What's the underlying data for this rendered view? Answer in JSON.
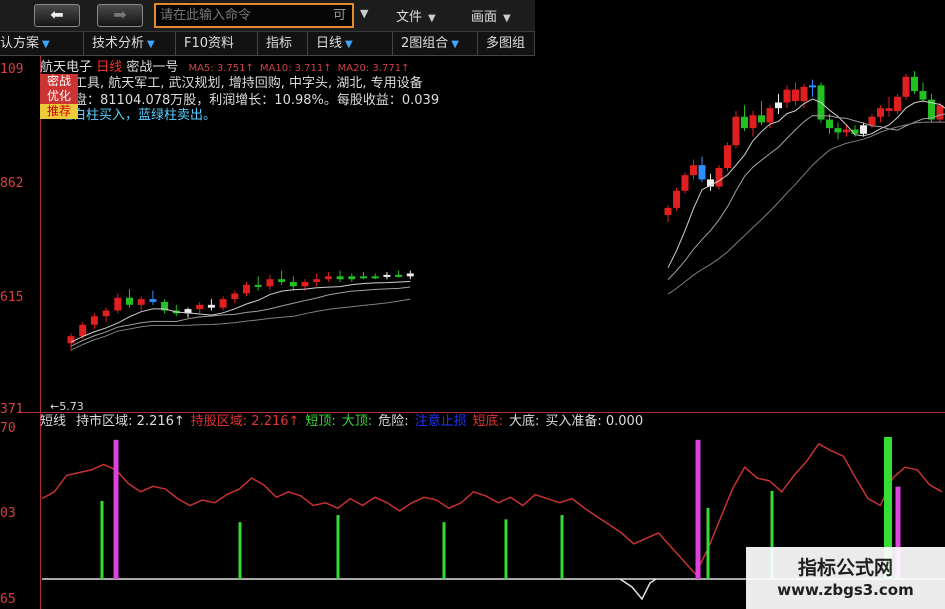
{
  "toolbar": {
    "back_icon": "back-arrow-icon",
    "forward_icon": "forward-arrow-icon",
    "command_placeholder": "请在此输入命令",
    "command_suffix": "可",
    "menu_file": "文件",
    "menu_view": "画面",
    "row2": [
      {
        "label": "认方案",
        "dropdown": true
      },
      {
        "label": "技术分析",
        "dropdown": true
      },
      {
        "label": "F10资料",
        "dropdown": false
      },
      {
        "label": "指标",
        "dropdown": false
      },
      {
        "label": "日线",
        "dropdown": true
      },
      {
        "label": "2图组合",
        "dropdown": true
      },
      {
        "label": "多图组",
        "dropdown": false
      }
    ]
  },
  "stock": {
    "name": "航天电子",
    "period": "日线",
    "strategy": "密战一号",
    "ma": [
      {
        "label": "MA5:",
        "value": "3.751"
      },
      {
        "label": "MA10:",
        "value": "3.711"
      },
      {
        "label": "MA20:",
        "value": "3.771"
      }
    ],
    "concepts": "交通工具, 航天军工, 武汉规划, 增持回购, 中字头, 湖北, 专用设备",
    "stats": "畅通盘：81104.078万股，利润增长：10.98%。每股收益：0.039",
    "hint_buy": "红白柱买入，",
    "hint_sell": "蓝绿柱卖出。"
  },
  "tags": [
    "密战",
    "优化",
    "推荐"
  ],
  "y_axis": {
    "main": [
      "109",
      "862",
      "615",
      "371"
    ],
    "indicator": [
      "70",
      "03",
      "65"
    ],
    "min_label": "←5.73"
  },
  "indicator": {
    "name": "短线",
    "items": [
      {
        "text": "持市区域: 2.216↑",
        "color": "#dddddd"
      },
      {
        "text": "持股区域: 2.216↑",
        "color": "#e33333"
      },
      {
        "text": "短顶:",
        "color": "#33dd33"
      },
      {
        "text": "大顶:",
        "color": "#33dd33"
      },
      {
        "text": "危险:",
        "color": "#dddddd"
      },
      {
        "text": "注意止损",
        "color": "#2233ff"
      },
      {
        "text": "短底:",
        "color": "#e33333"
      },
      {
        "text": "大底:",
        "color": "#dddddd"
      },
      {
        "text": "买入准备: 0.000",
        "color": "#dddddd"
      }
    ]
  },
  "watermark": {
    "title": "指标公式网",
    "url": "www.zbgs3.com"
  },
  "colors": {
    "up": "#e02020",
    "down": "#22c022",
    "buy_signal": "#f0f0f0",
    "sell_signal": "#2f8fff",
    "line": "#c83232",
    "ma": "#b0b0b0"
  },
  "chart_data": {
    "type": "candlestick",
    "candles": [
      {
        "o": 4.15,
        "h": 4.22,
        "l": 4.1,
        "c": 4.2,
        "t": "up"
      },
      {
        "o": 4.2,
        "h": 4.3,
        "l": 4.18,
        "c": 4.28,
        "t": "up"
      },
      {
        "o": 4.28,
        "h": 4.36,
        "l": 4.25,
        "c": 4.34,
        "t": "up"
      },
      {
        "o": 4.34,
        "h": 4.4,
        "l": 4.3,
        "c": 4.38,
        "t": "up"
      },
      {
        "o": 4.38,
        "h": 4.5,
        "l": 4.36,
        "c": 4.47,
        "t": "up"
      },
      {
        "o": 4.47,
        "h": 4.53,
        "l": 4.4,
        "c": 4.42,
        "t": "down"
      },
      {
        "o": 4.42,
        "h": 4.48,
        "l": 4.38,
        "c": 4.46,
        "t": "up"
      },
      {
        "o": 4.46,
        "h": 4.52,
        "l": 4.42,
        "c": 4.44,
        "t": "sell"
      },
      {
        "o": 4.44,
        "h": 4.46,
        "l": 4.36,
        "c": 4.38,
        "t": "down"
      },
      {
        "o": 4.38,
        "h": 4.42,
        "l": 4.34,
        "c": 4.36,
        "t": "down"
      },
      {
        "o": 4.36,
        "h": 4.4,
        "l": 4.33,
        "c": 4.39,
        "t": "buy"
      },
      {
        "o": 4.39,
        "h": 4.44,
        "l": 4.36,
        "c": 4.42,
        "t": "up"
      },
      {
        "o": 4.42,
        "h": 4.46,
        "l": 4.38,
        "c": 4.4,
        "t": "buy"
      },
      {
        "o": 4.4,
        "h": 4.48,
        "l": 4.38,
        "c": 4.46,
        "t": "up"
      },
      {
        "o": 4.46,
        "h": 4.52,
        "l": 4.43,
        "c": 4.5,
        "t": "up"
      },
      {
        "o": 4.5,
        "h": 4.58,
        "l": 4.48,
        "c": 4.56,
        "t": "up"
      },
      {
        "o": 4.56,
        "h": 4.62,
        "l": 4.52,
        "c": 4.55,
        "t": "down"
      },
      {
        "o": 4.55,
        "h": 4.63,
        "l": 4.53,
        "c": 4.6,
        "t": "up"
      },
      {
        "o": 4.6,
        "h": 4.66,
        "l": 4.56,
        "c": 4.58,
        "t": "down"
      },
      {
        "o": 4.58,
        "h": 4.62,
        "l": 4.52,
        "c": 4.55,
        "t": "down"
      },
      {
        "o": 4.55,
        "h": 4.6,
        "l": 4.52,
        "c": 4.58,
        "t": "up"
      },
      {
        "o": 4.58,
        "h": 4.64,
        "l": 4.55,
        "c": 4.6,
        "t": "up"
      },
      {
        "o": 4.6,
        "h": 4.65,
        "l": 4.58,
        "c": 4.62,
        "t": "up"
      },
      {
        "o": 4.62,
        "h": 4.66,
        "l": 4.58,
        "c": 4.6,
        "t": "down"
      },
      {
        "o": 4.6,
        "h": 4.64,
        "l": 4.58,
        "c": 4.62,
        "t": "down"
      },
      {
        "o": 4.62,
        "h": 4.65,
        "l": 4.6,
        "c": 4.62,
        "t": "down"
      },
      {
        "o": 4.62,
        "h": 4.64,
        "l": 4.6,
        "c": 4.62,
        "t": "down"
      },
      {
        "o": 4.62,
        "h": 4.65,
        "l": 4.6,
        "c": 4.63,
        "t": "buy"
      },
      {
        "o": 4.63,
        "h": 4.66,
        "l": 4.61,
        "c": 4.62,
        "t": "down"
      },
      {
        "o": 4.62,
        "h": 4.66,
        "l": 4.6,
        "c": 4.64,
        "t": "buy"
      },
      {
        "o": 5.05,
        "h": 5.12,
        "l": 5.0,
        "c": 5.1,
        "t": "up"
      },
      {
        "o": 5.1,
        "h": 5.24,
        "l": 5.08,
        "c": 5.22,
        "t": "up"
      },
      {
        "o": 5.22,
        "h": 5.35,
        "l": 5.2,
        "c": 5.33,
        "t": "up"
      },
      {
        "o": 5.33,
        "h": 5.44,
        "l": 5.3,
        "c": 5.4,
        "t": "up"
      },
      {
        "o": 5.4,
        "h": 5.46,
        "l": 5.28,
        "c": 5.3,
        "t": "sell"
      },
      {
        "o": 5.3,
        "h": 5.34,
        "l": 5.22,
        "c": 5.25,
        "t": "buy"
      },
      {
        "o": 5.25,
        "h": 5.4,
        "l": 5.23,
        "c": 5.38,
        "t": "up"
      },
      {
        "o": 5.38,
        "h": 5.56,
        "l": 5.36,
        "c": 5.54,
        "t": "up"
      },
      {
        "o": 5.54,
        "h": 5.78,
        "l": 5.52,
        "c": 5.74,
        "t": "up"
      },
      {
        "o": 5.74,
        "h": 5.82,
        "l": 5.64,
        "c": 5.66,
        "t": "down"
      },
      {
        "o": 5.66,
        "h": 5.78,
        "l": 5.6,
        "c": 5.75,
        "t": "up"
      },
      {
        "o": 5.75,
        "h": 5.85,
        "l": 5.68,
        "c": 5.7,
        "t": "down"
      },
      {
        "o": 5.7,
        "h": 5.82,
        "l": 5.66,
        "c": 5.8,
        "t": "up"
      },
      {
        "o": 5.8,
        "h": 5.9,
        "l": 5.76,
        "c": 5.84,
        "t": "buy"
      },
      {
        "o": 5.84,
        "h": 5.96,
        "l": 5.8,
        "c": 5.93,
        "t": "up"
      },
      {
        "o": 5.93,
        "h": 5.98,
        "l": 5.82,
        "c": 5.85,
        "t": "up"
      },
      {
        "o": 5.85,
        "h": 5.97,
        "l": 5.8,
        "c": 5.95,
        "t": "up"
      },
      {
        "o": 5.95,
        "h": 6.0,
        "l": 5.88,
        "c": 5.96,
        "t": "sell"
      },
      {
        "o": 5.96,
        "h": 5.98,
        "l": 5.7,
        "c": 5.72,
        "t": "down"
      },
      {
        "o": 5.72,
        "h": 5.76,
        "l": 5.62,
        "c": 5.66,
        "t": "down"
      },
      {
        "o": 5.66,
        "h": 5.7,
        "l": 5.58,
        "c": 5.63,
        "t": "down"
      },
      {
        "o": 5.63,
        "h": 5.68,
        "l": 5.6,
        "c": 5.65,
        "t": "up"
      },
      {
        "o": 5.65,
        "h": 5.68,
        "l": 5.6,
        "c": 5.62,
        "t": "down"
      },
      {
        "o": 5.62,
        "h": 5.7,
        "l": 5.6,
        "c": 5.68,
        "t": "buy"
      },
      {
        "o": 5.68,
        "h": 5.76,
        "l": 5.66,
        "c": 5.74,
        "t": "up"
      },
      {
        "o": 5.74,
        "h": 5.82,
        "l": 5.7,
        "c": 5.8,
        "t": "up"
      },
      {
        "o": 5.8,
        "h": 5.88,
        "l": 5.74,
        "c": 5.78,
        "t": "up"
      },
      {
        "o": 5.78,
        "h": 5.9,
        "l": 5.76,
        "c": 5.88,
        "t": "up"
      },
      {
        "o": 5.88,
        "h": 6.04,
        "l": 5.86,
        "c": 6.02,
        "t": "up"
      },
      {
        "o": 6.02,
        "h": 6.06,
        "l": 5.9,
        "c": 5.92,
        "t": "down"
      },
      {
        "o": 5.92,
        "h": 5.98,
        "l": 5.84,
        "c": 5.86,
        "t": "down"
      },
      {
        "o": 5.86,
        "h": 5.9,
        "l": 5.7,
        "c": 5.72,
        "t": "down"
      },
      {
        "o": 5.72,
        "h": 5.84,
        "l": 5.7,
        "c": 5.82,
        "t": "up"
      },
      {
        "o": 5.82,
        "h": 5.9,
        "l": 5.76,
        "c": 5.8,
        "t": "down"
      }
    ],
    "indicator_line": [
      0.55,
      0.6,
      0.72,
      0.74,
      0.76,
      0.8,
      0.76,
      0.66,
      0.6,
      0.64,
      0.62,
      0.55,
      0.5,
      0.54,
      0.52,
      0.58,
      0.62,
      0.7,
      0.65,
      0.56,
      0.6,
      0.57,
      0.5,
      0.52,
      0.48,
      0.55,
      0.5,
      0.56,
      0.52,
      0.46,
      0.52,
      0.56,
      0.54,
      0.48,
      0.52,
      0.6,
      0.57,
      0.52,
      0.56,
      0.5,
      0.58,
      0.55,
      0.52,
      0.55,
      0.48,
      0.42,
      0.36,
      0.3,
      0.22,
      0.26,
      0.3,
      0.2,
      0.1,
      0.0,
      0.18,
      0.4,
      0.62,
      0.78,
      0.7,
      0.68,
      0.6,
      0.72,
      0.82,
      0.95,
      0.9,
      0.86,
      0.7,
      0.55,
      0.5,
      0.7,
      0.78,
      0.76,
      0.65,
      0.6
    ],
    "signals": [
      {
        "i": 5,
        "h": 0.55,
        "c": "#33dd33"
      },
      {
        "i": 6,
        "h": 0.98,
        "c": "#e040e0"
      },
      {
        "i": 16,
        "h": 0.4,
        "c": "#33dd33"
      },
      {
        "i": 23,
        "h": 0.45,
        "c": "#33dd33"
      },
      {
        "i": 31,
        "h": 0.4,
        "c": "#33dd33"
      },
      {
        "i": 38,
        "h": 0.42,
        "c": "#33dd33"
      },
      {
        "i": 44,
        "h": 0.45,
        "c": "#33dd33"
      },
      {
        "i": 63,
        "h": 0.98,
        "c": "#e040e0"
      },
      {
        "i": 64,
        "h": 0.5,
        "c": "#33dd33"
      },
      {
        "i": 70,
        "h": 0.62,
        "c": "#33dd33"
      },
      {
        "i": 79,
        "h": 1.0,
        "c": "#33dd33"
      },
      {
        "i": 80,
        "h": 0.65,
        "c": "#e040e0"
      }
    ]
  }
}
